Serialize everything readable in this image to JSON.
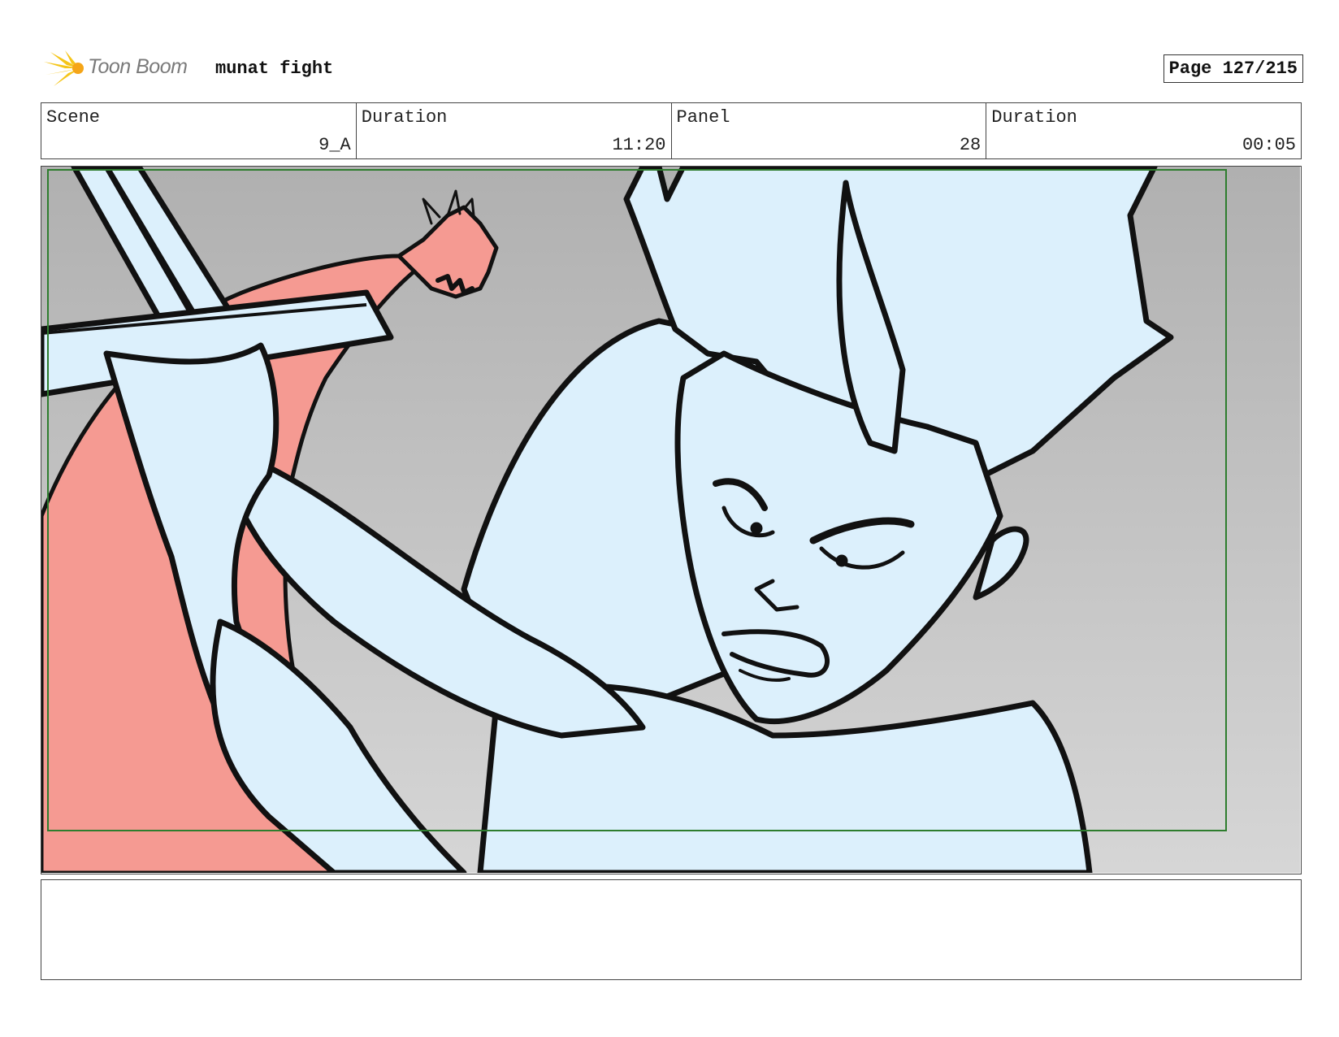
{
  "header": {
    "logo_text": "Toon Boom",
    "project_title": "munat fight",
    "page_label": "Page 127/215"
  },
  "info": {
    "scene_label": "Scene",
    "scene_value": "9_A",
    "scene_duration_label": "Duration",
    "scene_duration_value": "11:20",
    "panel_label": "Panel",
    "panel_value": "28",
    "panel_duration_label": "Duration",
    "panel_duration_value": "00:05"
  },
  "notes": {
    "text": ""
  },
  "colors": {
    "character_fill": "#dcf0fc",
    "dragon_fill": "#f59a92",
    "safe_frame": "#2e7d2e",
    "logo_star": "#f5c518"
  }
}
